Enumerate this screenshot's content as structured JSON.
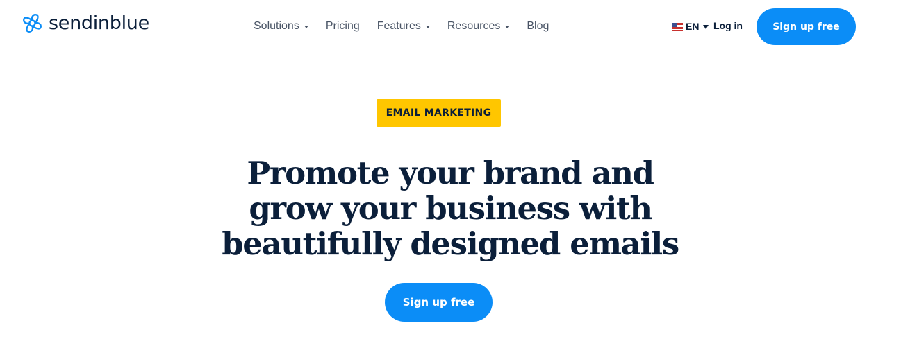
{
  "header": {
    "logo_text": "sendinblue",
    "nav": [
      {
        "label": "Solutions",
        "has_dropdown": true
      },
      {
        "label": "Pricing",
        "has_dropdown": false
      },
      {
        "label": "Features",
        "has_dropdown": true
      },
      {
        "label": "Resources",
        "has_dropdown": true
      },
      {
        "label": "Blog",
        "has_dropdown": false
      }
    ],
    "language": {
      "label": "EN",
      "flag": "us-flag-icon"
    },
    "login_label": "Log in",
    "signup_label": "Sign up free"
  },
  "hero": {
    "badge": "EMAIL MARKETING",
    "headline_lines": [
      "Promote your brand and",
      "grow your business with",
      "beautifully designed emails"
    ],
    "cta_label": "Sign up free"
  },
  "colors": {
    "brand_blue": "#0b8df7",
    "navy_text": "#0b1f3a",
    "badge_yellow": "#ffc600",
    "nav_gray": "#4a5566"
  }
}
